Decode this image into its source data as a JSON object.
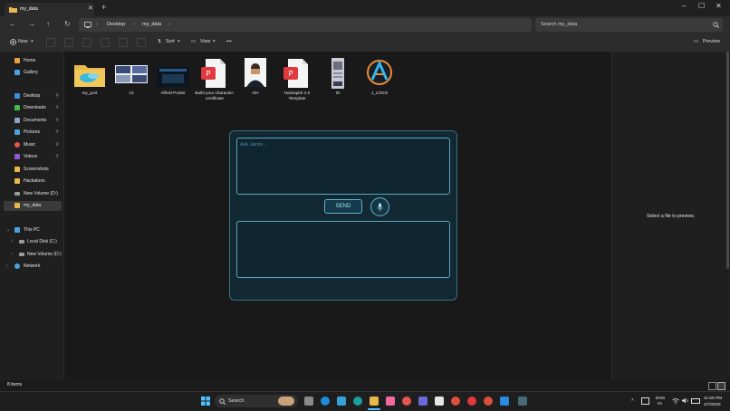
{
  "window": {
    "tab_title": "my_data",
    "new_tab": "+",
    "minimize": "–",
    "maximize": "☐",
    "close": "✕"
  },
  "nav": {
    "back": "←",
    "forward": "→",
    "up": "↑",
    "refresh": "↻",
    "breadcrumb": [
      "Desktop",
      "my_data"
    ],
    "search_placeholder": "Search my_data"
  },
  "toolbar": {
    "new_label": "New",
    "sort_label": "Sort",
    "view_label": "View",
    "more_label": "•••",
    "preview_label": "Preview"
  },
  "sidebar": {
    "items": [
      {
        "label": "Home",
        "color": "#e8a33d"
      },
      {
        "label": "Gallery",
        "color": "#4aa3df"
      },
      {
        "label": "Desktop",
        "color": "#3c8ddc",
        "pinned": true
      },
      {
        "label": "Downloads",
        "color": "#3fb950",
        "pinned": true
      },
      {
        "label": "Documents",
        "color": "#8aa4c8",
        "pinned": true
      },
      {
        "label": "Pictures",
        "color": "#4aa3df",
        "pinned": true
      },
      {
        "label": "Music",
        "color": "#e0584f",
        "pinned": true
      },
      {
        "label": "Videos",
        "color": "#8b5bd6",
        "pinned": true
      },
      {
        "label": "Screenshots",
        "color": "#e8b84a"
      },
      {
        "label": "Hackatons",
        "color": "#e8b84a"
      },
      {
        "label": "New Volume (D:)",
        "color": "#9a9a9a"
      },
      {
        "label": "my_data",
        "color": "#e8b84a",
        "selected": true
      }
    ],
    "tree": [
      {
        "label": "This PC",
        "color": "#4aa3df",
        "chevron": "v"
      },
      {
        "label": "Local Disk (C:)",
        "color": "#9a9a9a",
        "chevron": ">"
      },
      {
        "label": "New Volume (D:)",
        "color": "#9a9a9a",
        "chevron": ">"
      },
      {
        "label": "Network",
        "color": "#4aa3df",
        "chevron": ">"
      }
    ]
  },
  "files": [
    {
      "name": "my_port",
      "icon": "folder-icon"
    },
    {
      "name": "10",
      "icon": "document-thumbnail"
    },
    {
      "name": "Alfred-Poster",
      "icon": "poster-thumbnail"
    },
    {
      "name": "Build your character-certificate",
      "icon": "pdf-icon"
    },
    {
      "name": "GH",
      "icon": "photo-thumbnail"
    },
    {
      "name": "Hackspirit 2.0 Template",
      "icon": "pdf-icon"
    },
    {
      "name": "ID",
      "icon": "id-card-thumbnail"
    },
    {
      "name": "J_LOGO",
      "icon": "logo-thumbnail"
    }
  ],
  "dialog": {
    "ask_placeholder": "Ask Jarvis...",
    "send_label": "SEND",
    "mic_icon": "microphone-icon"
  },
  "preview": {
    "message": "Select a file to preview."
  },
  "status": {
    "item_count": "8 items"
  },
  "taskbar": {
    "search_label": "Search",
    "lang_top": "ENG",
    "lang_bottom": "IN",
    "time": "11:56 PM",
    "date": "4/7/2026"
  },
  "colors": {
    "accent": "#62b3cf",
    "dialog_bg": "#122833",
    "pdf_red": "#e0393e"
  }
}
